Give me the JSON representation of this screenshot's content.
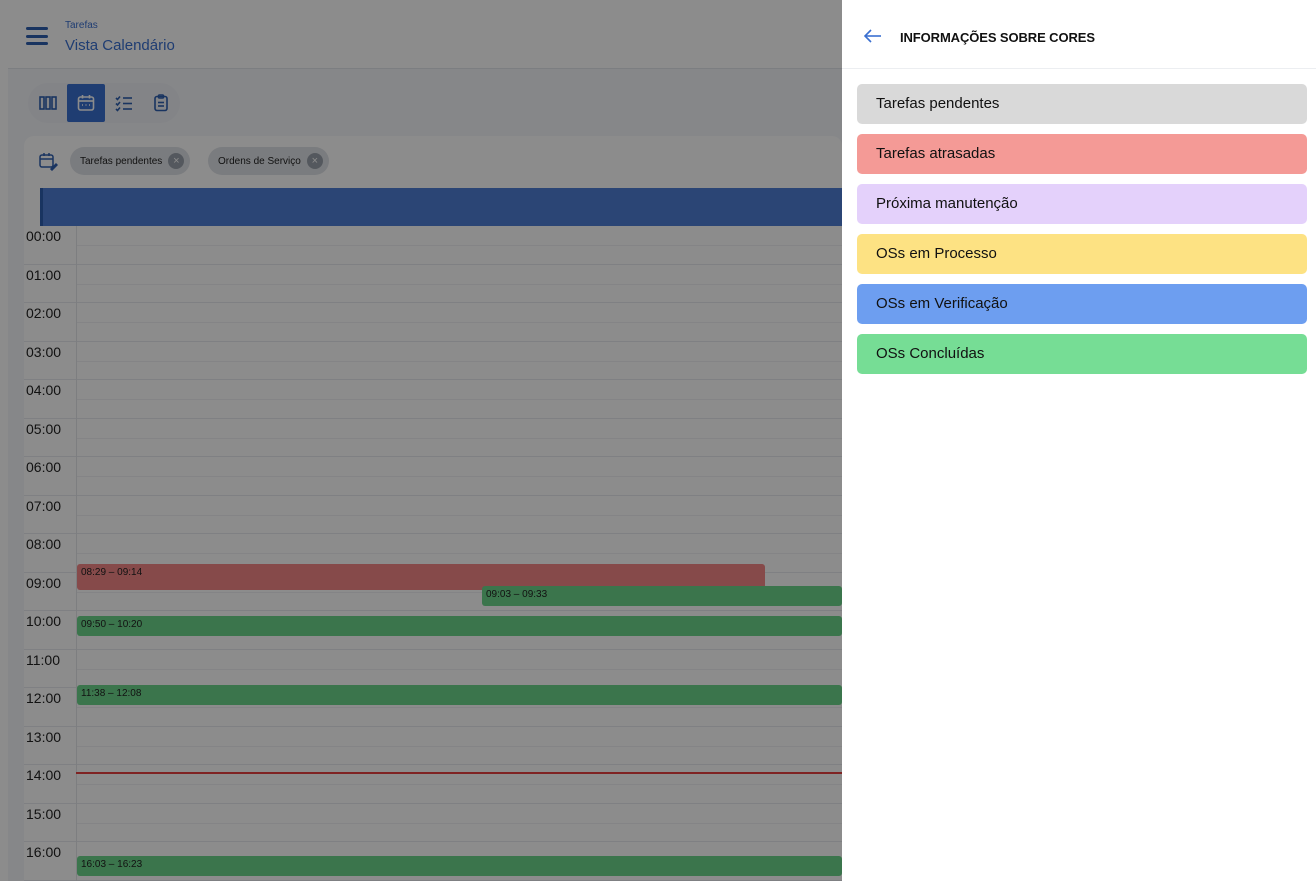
{
  "header": {
    "section": "Tarefas",
    "title": "Vista Calendário"
  },
  "toolbar": {
    "buttons": [
      {
        "icon": "columns-icon"
      },
      {
        "icon": "calendar-icon",
        "active": true
      },
      {
        "icon": "checklist-icon"
      },
      {
        "icon": "clipboard-icon"
      }
    ]
  },
  "filters": {
    "chips": [
      {
        "label": "Tarefas pendentes"
      },
      {
        "label": "Ordens de Serviço"
      }
    ]
  },
  "calendar": {
    "hours": [
      "00:00",
      "01:00",
      "02:00",
      "03:00",
      "04:00",
      "05:00",
      "06:00",
      "07:00",
      "08:00",
      "09:00",
      "10:00",
      "11:00",
      "12:00",
      "13:00",
      "14:00",
      "15:00",
      "16:00"
    ],
    "events": [
      {
        "time": "08:29 – 09:14",
        "color": "#f48888"
      },
      {
        "time": "09:03 – 09:33",
        "color": "#6cd68a"
      },
      {
        "time": "09:50 – 10:20",
        "color": "#6cd68a"
      },
      {
        "time": "11:38 – 12:08",
        "color": "#6cd68a"
      },
      {
        "time": "16:03 – 16:23",
        "color": "#6cd68a"
      }
    ]
  },
  "panel": {
    "title": "INFORMAÇÕES SOBRE CORES",
    "legend": [
      {
        "label": "Tarefas pendentes",
        "color": "#d9d9d9"
      },
      {
        "label": "Tarefas atrasadas",
        "color": "#f49a96"
      },
      {
        "label": "Próxima manutenção",
        "color": "#e4d1fb"
      },
      {
        "label": "OSs em Processo",
        "color": "#fde283"
      },
      {
        "label": "OSs em Verificação",
        "color": "#6d9ef0"
      },
      {
        "label": "OSs Concluídas",
        "color": "#76dd95"
      }
    ]
  }
}
